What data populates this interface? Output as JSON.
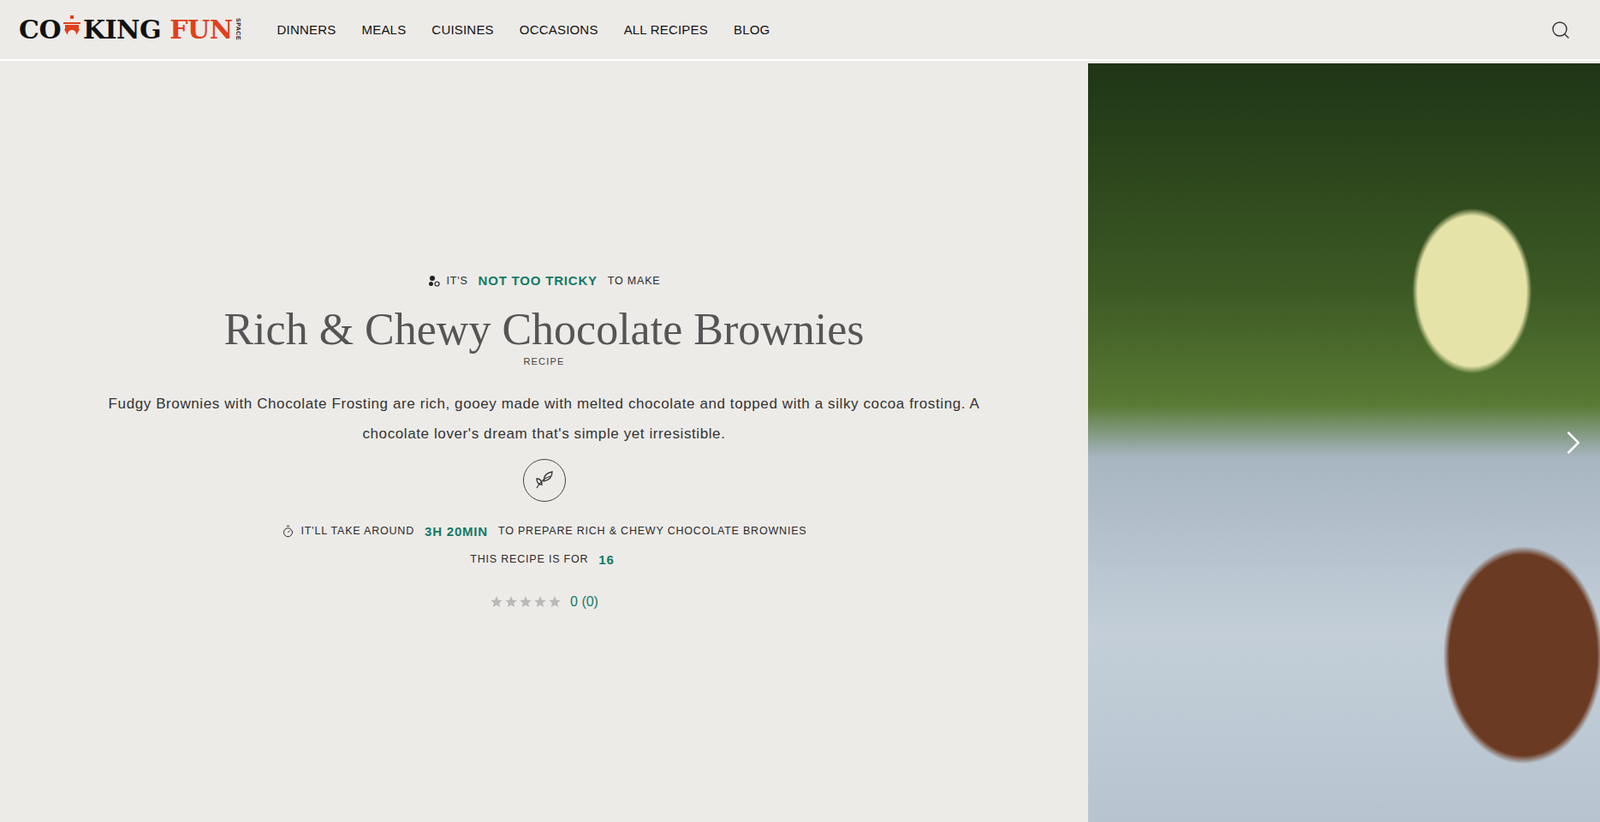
{
  "logo": {
    "prefix": "CO",
    "middle": "KING",
    "accent": "FUN",
    "tag": "SPACE"
  },
  "nav": [
    {
      "label": "DINNERS"
    },
    {
      "label": "MEALS"
    },
    {
      "label": "CUISINES"
    },
    {
      "label": "OCCASIONS"
    },
    {
      "label": "ALL RECIPES"
    },
    {
      "label": "BLOG"
    }
  ],
  "recipe": {
    "difficulty": {
      "prefix": "IT'S",
      "value": "NOT TOO TRICKY",
      "suffix": "TO MAKE"
    },
    "title": "Rich & Chewy Chocolate Brownies",
    "subtitle": "RECIPE",
    "description": "Fudgy Brownies with Chocolate Frosting are rich, gooey made with melted chocolate and topped with a silky cocoa frosting. A chocolate lover's dream that's simple yet irresistible.",
    "time": {
      "prefix": "IT'LL TAKE AROUND",
      "value": "3H 20MIN",
      "suffix": "TO PREPARE RICH & CHEWY CHOCOLATE BROWNIES"
    },
    "servings": {
      "prefix": "THIS RECIPE IS FOR",
      "value": "16"
    },
    "rating": {
      "stars": 0,
      "reading": "0 (0)"
    }
  }
}
